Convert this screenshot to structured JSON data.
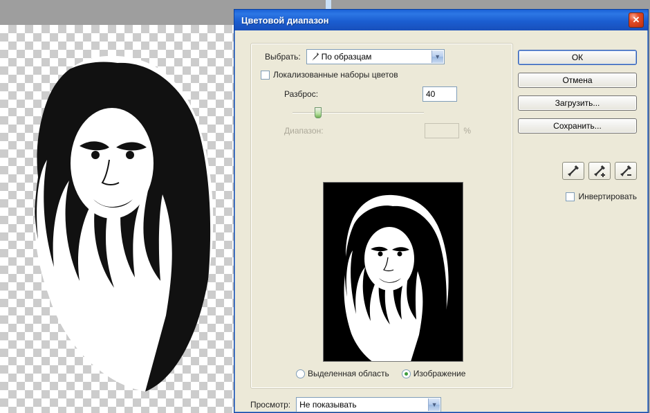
{
  "dialog": {
    "title": "Цветовой диапазон",
    "select_label": "Выбрать:",
    "select_value": "По образцам",
    "localized_checkbox": "Локализованные наборы цветов",
    "fuzziness_label": "Разброс:",
    "fuzziness_value": "40",
    "range_label": "Диапазон:",
    "range_value": "",
    "range_unit": "%",
    "radio_selection": "Выделенная область",
    "radio_image": "Изображение",
    "preview_label": "Просмотр:",
    "preview_value": "Не показывать"
  },
  "buttons": {
    "ok": "ОК",
    "cancel": "Отмена",
    "load": "Загрузить...",
    "save": "Сохранить..."
  },
  "invert_label": "Инвертировать"
}
